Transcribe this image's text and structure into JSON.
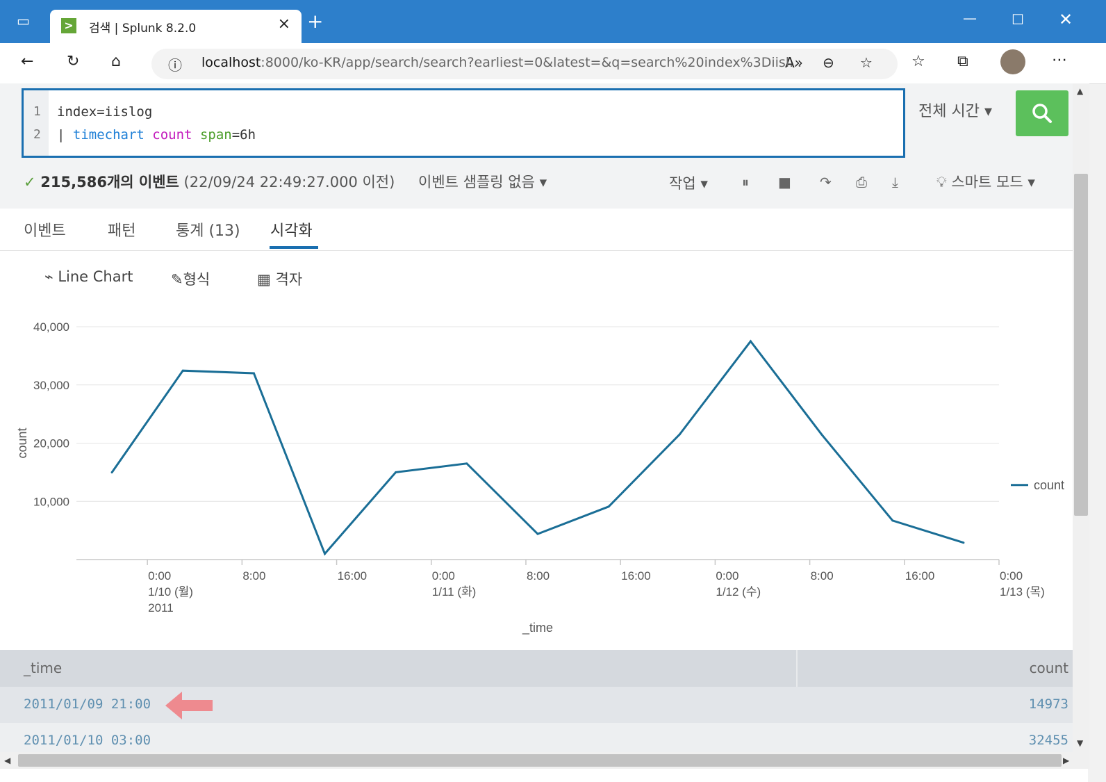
{
  "browser": {
    "tab_title": "검색 | Splunk 8.2.0",
    "favicon_glyph": ">",
    "url_host": "localhost",
    "url_rest": ":8000/ko-KR/app/search/search?earliest=0&latest=&q=search%20index%3Diisl..."
  },
  "search": {
    "lines": [
      {
        "num": "1",
        "text": "index=iislog"
      },
      {
        "num": "2",
        "pipe": "| ",
        "cmd": "timechart",
        "func": "count",
        "arg": "span",
        "val": "=6h"
      }
    ],
    "time_range": "전체 시간 ▾",
    "submit_icon": "search-icon"
  },
  "status": {
    "check": "✓",
    "event_count": "215,586개의 이벤트",
    "timestamp": "(22/09/24 22:49:27.000 이전)",
    "sampling": "이벤트 샘플링 없음 ▾",
    "job": "작업 ▾",
    "mode": "스마트 모드 ▾"
  },
  "tabs": [
    {
      "label": "이벤트"
    },
    {
      "label": "패턴"
    },
    {
      "label": "통계 (13)"
    },
    {
      "label": "시각화"
    }
  ],
  "viz": {
    "chart_type": "Line Chart",
    "format": "형식",
    "grid": "격자"
  },
  "chart_data": {
    "type": "line",
    "xlabel": "_time",
    "ylabel": "count",
    "ylim": [
      0,
      40000
    ],
    "yticks": [
      "10,000",
      "20,000",
      "30,000",
      "40,000"
    ],
    "grid": true,
    "legend_position": "right",
    "x_tick_labels": [
      [
        "0:00",
        "1/10 (월)",
        "2011"
      ],
      [
        "8:00"
      ],
      [
        "16:00"
      ],
      [
        "0:00",
        "1/11 (화)"
      ],
      [
        "8:00"
      ],
      [
        "16:00"
      ],
      [
        "0:00",
        "1/12 (수)"
      ],
      [
        "8:00"
      ],
      [
        "16:00"
      ],
      [
        "0:00",
        "1/13 (목)"
      ]
    ],
    "x": [
      "2011/01/09 21:00",
      "2011/01/10 03:00",
      "2011/01/10 09:00",
      "2011/01/10 15:00",
      "2011/01/10 21:00",
      "2011/01/11 03:00",
      "2011/01/11 09:00",
      "2011/01/11 15:00",
      "2011/01/11 21:00",
      "2011/01/12 03:00",
      "2011/01/12 09:00",
      "2011/01/12 15:00",
      "2011/01/12 21:00"
    ],
    "series": [
      {
        "name": "count",
        "color": "#1a6e96",
        "values": [
          14973,
          32455,
          32000,
          1000,
          15000,
          16500,
          4400,
          9100,
          21500,
          37500,
          21500,
          6700,
          2900
        ]
      }
    ]
  },
  "table": {
    "headers": [
      "_time",
      "count"
    ],
    "rows": [
      {
        "time": "2011/01/09 21:00",
        "count": "14973"
      },
      {
        "time": "2011/01/10 03:00",
        "count": "32455"
      }
    ]
  }
}
